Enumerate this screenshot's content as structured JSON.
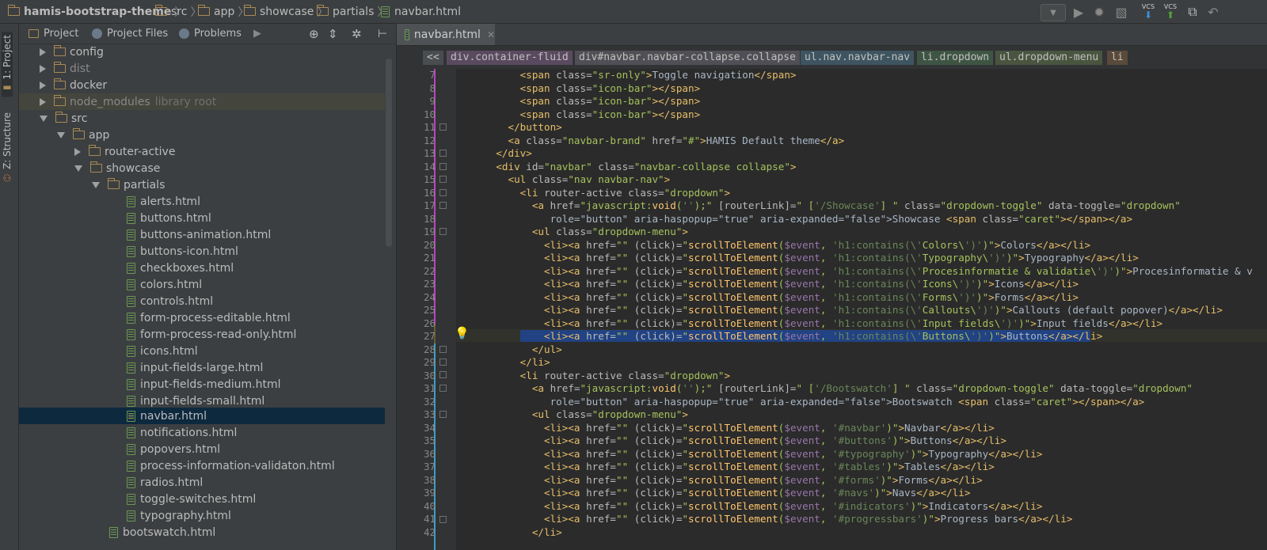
{
  "breadcrumbs": [
    "hamis-bootstrap-theme",
    "src",
    "app",
    "showcase",
    "partials",
    "navbar.html"
  ],
  "toolbar": {
    "vcs1": "VCS",
    "vcs2": "VCS"
  },
  "left_strip": {
    "project": "1: Project",
    "structure": "Z: Structure"
  },
  "project_tabs": [
    "Project",
    "Project Files",
    "Problems"
  ],
  "tree": [
    {
      "label": "config",
      "hint": ""
    },
    {
      "label": "dist",
      "hint": ""
    },
    {
      "label": "docker",
      "hint": ""
    },
    {
      "label": "node_modules",
      "hint": "library root"
    },
    {
      "label": "src",
      "hint": ""
    },
    {
      "label": "app",
      "hint": ""
    },
    {
      "label": "router-active",
      "hint": ""
    },
    {
      "label": "showcase",
      "hint": ""
    },
    {
      "label": "partials",
      "hint": ""
    },
    {
      "label": "alerts.html"
    },
    {
      "label": "buttons.html"
    },
    {
      "label": "buttons-animation.html"
    },
    {
      "label": "buttons-icon.html"
    },
    {
      "label": "checkboxes.html"
    },
    {
      "label": "colors.html"
    },
    {
      "label": "controls.html"
    },
    {
      "label": "form-process-editable.html"
    },
    {
      "label": "form-process-read-only.html"
    },
    {
      "label": "icons.html"
    },
    {
      "label": "input-fields-large.html"
    },
    {
      "label": "input-fields-medium.html"
    },
    {
      "label": "input-fields-small.html"
    },
    {
      "label": "navbar.html"
    },
    {
      "label": "notifications.html"
    },
    {
      "label": "popovers.html"
    },
    {
      "label": "process-information-validaton.html"
    },
    {
      "label": "radios.html"
    },
    {
      "label": "toggle-switches.html"
    },
    {
      "label": "typography.html"
    },
    {
      "label": "bootswatch.html"
    }
  ],
  "editor_tab": "navbar.html",
  "tag_crumbs": [
    "<<",
    "div.container-fluid",
    "div#navbar.navbar-collapse.collapse",
    "ul.nav.navbar-nav",
    "li.dropdown",
    "ul.dropdown-menu",
    "li"
  ],
  "line_numbers": [
    "7",
    "8",
    "9",
    "10",
    "11",
    "12",
    "13",
    "14",
    "15",
    "16",
    "17",
    "18",
    "19",
    "20",
    "21",
    "22",
    "23",
    "24",
    "25",
    "26",
    "27",
    "28",
    "29",
    "30",
    "31",
    "32",
    "33",
    "34",
    "35",
    "36",
    "37",
    "38",
    "39",
    "40",
    "41",
    "42"
  ],
  "code_lines": [
    "        <span class=\"sr-only\">Toggle navigation</span>",
    "        <span class=\"icon-bar\"></span>",
    "        <span class=\"icon-bar\"></span>",
    "        <span class=\"icon-bar\"></span>",
    "      </button>",
    "      <a class=\"navbar-brand\" href=\"#\">HAMIS Default theme</a>",
    "    </div>",
    "    <div id=\"navbar\" class=\"navbar-collapse collapse\">",
    "      <ul class=\"nav navbar-nav\">",
    "        <li router-active class=\"dropdown\">",
    "          <a href=\"javascript:void('');\" [routerLink]=\" ['/Showcase'] \" class=\"dropdown-toggle\" data-toggle=\"dropdown\"",
    "             role=\"button\" aria-haspopup=\"true\" aria-expanded=\"false\">Showcase <span class=\"caret\"></span></a>",
    "          <ul class=\"dropdown-menu\">",
    "            <li><a href=\"\" (click)=\"scrollToElement($event, 'h1:contains(\\'Colors\\')')\">Colors</a></li>",
    "            <li><a href=\"\" (click)=\"scrollToElement($event, 'h1:contains(\\'Typography\\')')\">Typography</a></li>",
    "            <li><a href=\"\" (click)=\"scrollToElement($event, 'h1:contains(\\'Procesinformatie & validatie\\')')\">Procesinformatie & v",
    "            <li><a href=\"\" (click)=\"scrollToElement($event, 'h1:contains(\\'Icons\\')')\">Icons</a></li>",
    "            <li><a href=\"\" (click)=\"scrollToElement($event, 'h1:contains(\\'Forms\\')')\">Forms</a></li>",
    "            <li><a href=\"\" (click)=\"scrollToElement($event, 'h1:contains(\\'Callouts\\')')\">Callouts (default popover)</a></li>",
    "            <li><a href=\"\" (click)=\"scrollToElement($event, 'h1:contains(\\'Input fields\\')')\">Input fields</a></li>",
    "            <li><a href=\"\" (click)=\"scrollToElement($event, 'h1:contains(\\'Buttons\\')')\">Buttons</a></li>",
    "          </ul>",
    "        </li>",
    "        <li router-active class=\"dropdown\">",
    "          <a href=\"javascript:void('');\" [routerLink]=\" ['/Bootswatch'] \" class=\"dropdown-toggle\" data-toggle=\"dropdown\"",
    "             role=\"button\" aria-haspopup=\"true\" aria-expanded=\"false\">Bootswatch <span class=\"caret\"></span></a>",
    "          <ul class=\"dropdown-menu\">",
    "            <li><a href=\"\" (click)=\"scrollToElement($event, '#navbar')\">Navbar</a></li>",
    "            <li><a href=\"\" (click)=\"scrollToElement($event, '#buttons')\">Buttons</a></li>",
    "            <li><a href=\"\" (click)=\"scrollToElement($event, '#typography')\">Typography</a></li>",
    "            <li><a href=\"\" (click)=\"scrollToElement($event, '#tables')\">Tables</a></li>",
    "            <li><a href=\"\" (click)=\"scrollToElement($event, '#forms')\">Forms</a></li>",
    "            <li><a href=\"\" (click)=\"scrollToElement($event, '#navs')\">Navs</a></li>",
    "            <li><a href=\"\" (click)=\"scrollToElement($event, '#indicators')\">Indicators</a></li>",
    "            <li><a href=\"\" (click)=\"scrollToElement($event, '#progressbars')\">Progress bars</a></li>",
    "          </li>"
  ],
  "colors": {
    "background": "#2b2b2b",
    "panel": "#3c3f41",
    "tag": "#e8bf6a",
    "string": "#a5c25c",
    "keyword": "#cc7832",
    "selection": "#214283"
  }
}
